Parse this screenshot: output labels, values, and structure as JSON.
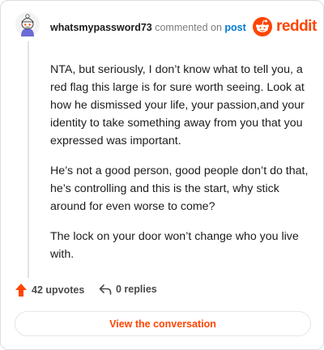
{
  "header": {
    "username": "whatsmypassword73",
    "action_text": "commented on",
    "post_link": "post",
    "brand": "reddit"
  },
  "comment": {
    "paragraphs": [
      "NTA, but seriously, I don’t know what to tell you, a red flag this large is for sure worth seeing. Look at how he dismissed your life, your passion,and your identity to take something away from you that you expressed was important.",
      "He’s not a good person, good people don’t do that, he’s controlling and this is the start, why stick around for even worse to come?",
      "The lock on your door won’t change who you live with."
    ]
  },
  "footer": {
    "upvotes": "42 upvotes",
    "replies": "0 replies",
    "view_button": "View the conversation"
  },
  "colors": {
    "accent": "#ff4500",
    "link": "#0079d3",
    "muted": "#7c7c7c"
  },
  "icons": {
    "avatar": "snoo-avatar-icon",
    "logo": "reddit-snoo-icon",
    "upvote": "upvote-arrow-icon",
    "reply": "reply-arrow-icon"
  }
}
